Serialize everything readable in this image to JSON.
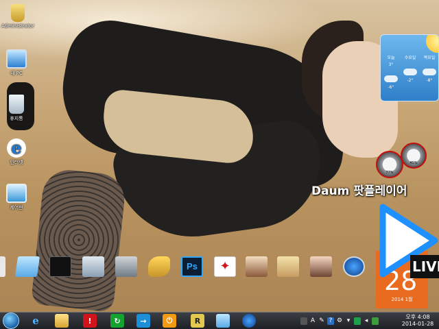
{
  "desktop": {
    "icons": [
      {
        "label": "Administrator",
        "icon": "user-folder-icon"
      },
      {
        "label": "내 PC",
        "icon": "computer-icon"
      },
      {
        "label": "휴지통",
        "icon": "recycle-bin-icon"
      },
      {
        "label": "인터넷",
        "icon": "internet-explorer-icon"
      },
      {
        "label": "제어판",
        "icon": "control-panel-icon"
      }
    ]
  },
  "weather": {
    "days": [
      {
        "day": "오늘",
        "temp": "3°",
        "low": "-6°"
      },
      {
        "day": "수요일",
        "temp": "",
        "low": "-2°"
      },
      {
        "day": "목요일",
        "temp": "",
        "low": "-8°"
      }
    ]
  },
  "gauges": {
    "cpu": "77%",
    "memory": "45%"
  },
  "daum": {
    "title": "Daum 팟플레이어",
    "live_badge": "LIVE"
  },
  "calendar": {
    "day": "28",
    "year_month": "2014 1월"
  },
  "dock": {
    "items": [
      "notepad-icon",
      "black-window-icon",
      "monitor-icon",
      "toolbox-icon",
      "tools-icon",
      "photoshop-icon",
      "acrobat-icon",
      "photo-1-icon",
      "photo-2-icon",
      "photo-3-icon",
      "media-player-icon"
    ]
  },
  "taskbar": {
    "ps_label": "Ps",
    "r_label": "R",
    "tray_a": "A",
    "clock_time": "오후 4:08",
    "clock_date": "2014-01-28"
  },
  "colors": {
    "calendar": "#e96b1f",
    "play": "#1e90ff"
  }
}
